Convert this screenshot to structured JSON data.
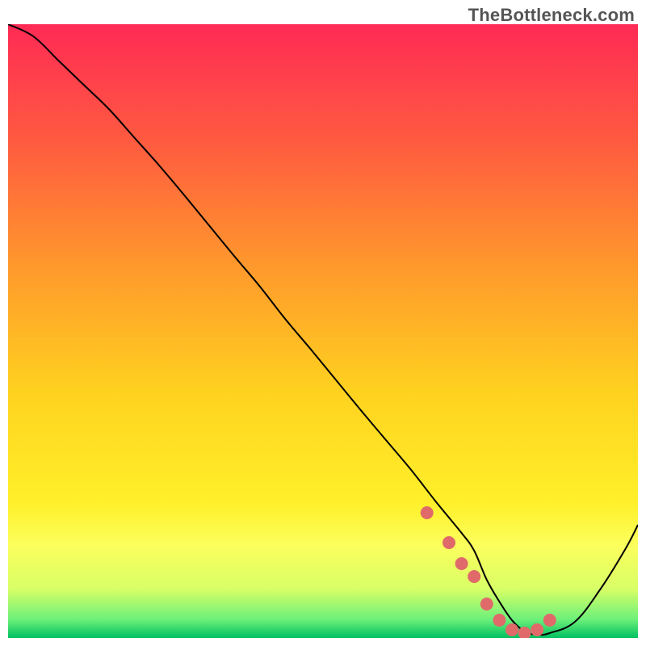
{
  "watermark": "TheBottleneck.com",
  "chart_data": {
    "type": "line",
    "title": "",
    "xlabel": "",
    "ylabel": "",
    "xlim": [
      0,
      100
    ],
    "ylim": [
      0,
      760
    ],
    "grid": false,
    "legend": false,
    "gradient_stops": [
      {
        "offset": 0.0,
        "color": "#ff2a55"
      },
      {
        "offset": 0.2,
        "color": "#ff5d3f"
      },
      {
        "offset": 0.4,
        "color": "#ff9a2c"
      },
      {
        "offset": 0.6,
        "color": "#ffd21f"
      },
      {
        "offset": 0.78,
        "color": "#fff02a"
      },
      {
        "offset": 0.85,
        "color": "#fbff5d"
      },
      {
        "offset": 0.92,
        "color": "#d8ff66"
      },
      {
        "offset": 0.97,
        "color": "#6cf07a"
      },
      {
        "offset": 1.0,
        "color": "#00c060"
      }
    ],
    "series": [
      {
        "name": "bottleneck-curve",
        "color": "#000000",
        "width": 2,
        "x": [
          0,
          4,
          8,
          12,
          16,
          20,
          24,
          28,
          32,
          36,
          40,
          44,
          48,
          52,
          56,
          60,
          64,
          68,
          72,
          74,
          76,
          78,
          80,
          82,
          84,
          86,
          90,
          94,
          98,
          100
        ],
        "values": [
          760,
          745,
          715,
          685,
          655,
          620,
          585,
          548,
          510,
          472,
          435,
          395,
          358,
          320,
          282,
          245,
          208,
          168,
          130,
          108,
          72,
          45,
          22,
          8,
          4,
          6,
          20,
          60,
          110,
          140
        ]
      }
    ],
    "marker_series": {
      "name": "optimal-range-dots",
      "color": "#e06a6a",
      "radius": 8,
      "x": [
        66.5,
        70,
        72,
        74,
        76,
        78,
        80,
        82,
        84,
        86
      ],
      "values": [
        155,
        118,
        92,
        76,
        42,
        22,
        10,
        6,
        10,
        22
      ]
    }
  }
}
